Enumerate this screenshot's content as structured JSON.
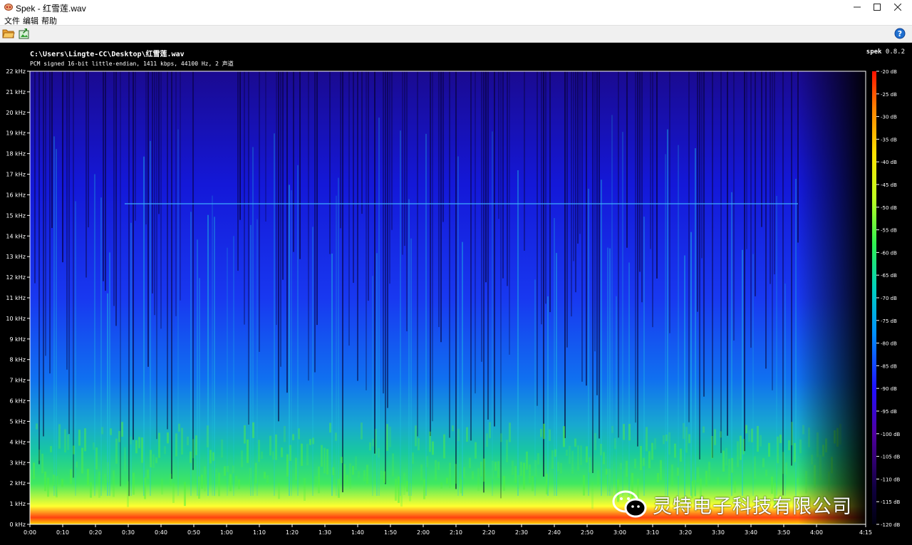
{
  "window": {
    "title": "Spek - 红雪莲.wav"
  },
  "menu": {
    "items": [
      "文件",
      "编辑",
      "帮助"
    ]
  },
  "file": {
    "path": "C:\\Users\\Lingte-CC\\Desktop\\红雪莲.wav",
    "info": "PCM signed 16-bit little-endian, 1411 kbps, 44100 Hz, 2 声道"
  },
  "brand": {
    "name": "spek",
    "version": "0.8.2"
  },
  "spectrogram": {
    "freq_ticks": [
      "0 kHz",
      "1 kHz",
      "2 kHz",
      "3 kHz",
      "4 kHz",
      "5 kHz",
      "6 kHz",
      "7 kHz",
      "8 kHz",
      "9 kHz",
      "10 kHz",
      "11 kHz",
      "12 kHz",
      "13 kHz",
      "14 kHz",
      "15 kHz",
      "16 kHz",
      "17 kHz",
      "18 kHz",
      "19 kHz",
      "20 kHz",
      "21 kHz",
      "22 kHz"
    ],
    "time_ticks": [
      "0:00",
      "0:10",
      "0:20",
      "0:30",
      "0:40",
      "0:50",
      "1:00",
      "1:10",
      "1:20",
      "1:30",
      "1:40",
      "1:50",
      "2:00",
      "2:10",
      "2:20",
      "2:30",
      "2:40",
      "2:50",
      "3:00",
      "3:10",
      "3:20",
      "3:30",
      "3:40",
      "3:50",
      "4:00",
      "4:15"
    ],
    "db_ticks": [
      "-20 dB",
      "-25 dB",
      "-30 dB",
      "-35 dB",
      "-40 dB",
      "-45 dB",
      "-50 dB",
      "-55 dB",
      "-60 dB",
      "-65 dB",
      "-70 dB",
      "-75 dB",
      "-80 dB",
      "-85 dB",
      "-90 dB",
      "-95 dB",
      "-100 dB",
      "-105 dB",
      "-110 dB",
      "-115 dB",
      "-120 dB"
    ],
    "colors": {
      "hot": "#ff2000",
      "yellow": "#ffff00",
      "green": "#30ff30",
      "cyan": "#00c0ff",
      "blue": "#1020ff",
      "deep": "#120070"
    }
  },
  "watermark": {
    "text": "灵特电子科技有限公司"
  }
}
